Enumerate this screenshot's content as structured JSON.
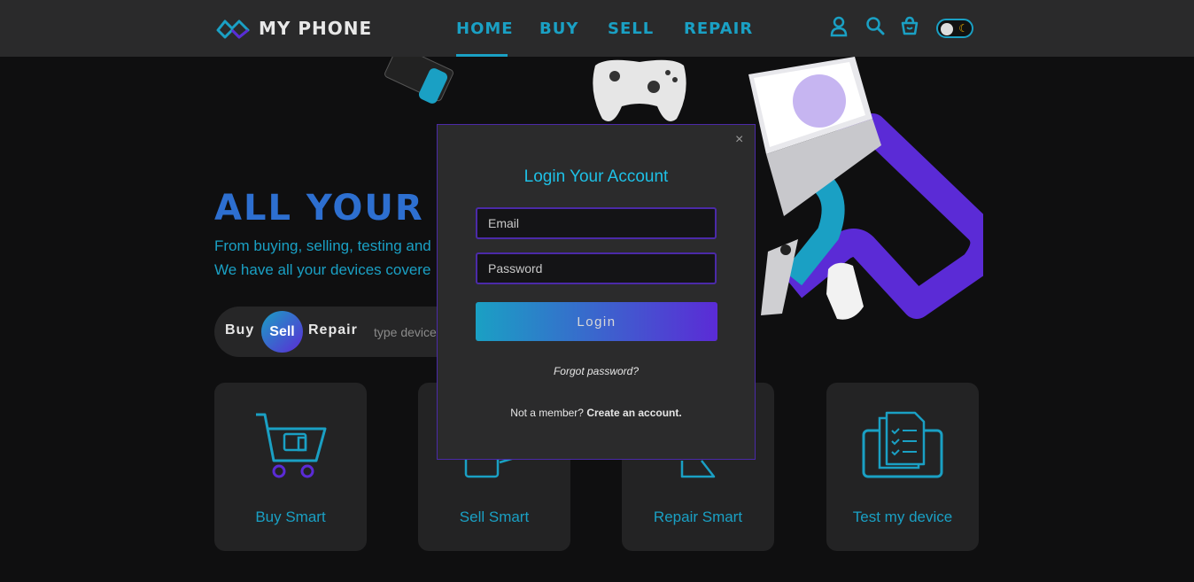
{
  "brand": {
    "name": "MY PHONE"
  },
  "nav": {
    "home": "HOME",
    "buy": "BUY",
    "sell": "SELL",
    "repair": "REPAIR"
  },
  "header_icons": [
    "user-icon",
    "search-icon",
    "basket-icon",
    "moon-icon"
  ],
  "hero": {
    "title": "ALL YOUR T",
    "subtitle_line1": "From buying, selling, testing and",
    "subtitle_line2": "We have all your devices covere"
  },
  "search": {
    "tab_buy": "Buy",
    "tab_sell": "Sell",
    "tab_repair": "Repair",
    "active_tab": "Sell",
    "placeholder": "type device"
  },
  "cards": [
    {
      "label": "Buy Smart",
      "icon": "cart-icon"
    },
    {
      "label": "Sell Smart",
      "icon": "sell-icon"
    },
    {
      "label": "Repair Smart",
      "icon": "repair-icon"
    },
    {
      "label": "Test my device",
      "icon": "checklist-icon"
    }
  ],
  "modal": {
    "title": "Login Your Account",
    "close": "×",
    "email_placeholder": "Email",
    "password_placeholder": "Password",
    "login_label": "Login",
    "forgot_label": "Forgot password?",
    "member_prefix": "Not a member?",
    "create_label": "Create an account."
  },
  "colors": {
    "accent": "#1aa0c4",
    "purple": "#5b2bd6",
    "background": "#0f0f10",
    "topbar": "#2a2a2b"
  }
}
